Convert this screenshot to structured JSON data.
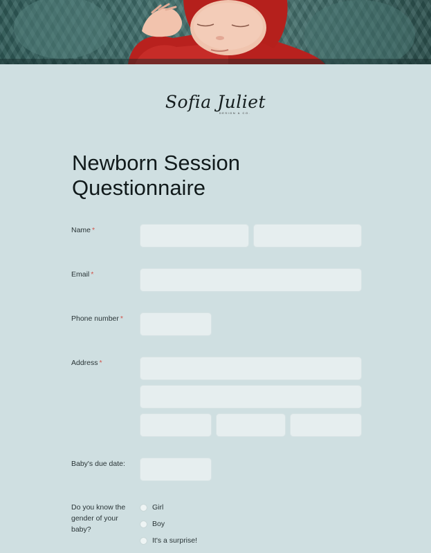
{
  "brand": {
    "name": "Sofia Juliet",
    "tagline": "DESIGN & CO."
  },
  "form": {
    "title_line1": "Newborn Session",
    "title_line2": "Questionnaire",
    "required_marker": "*",
    "fields": {
      "name": {
        "label": "Name",
        "first_value": "",
        "last_value": ""
      },
      "email": {
        "label": "Email",
        "value": ""
      },
      "phone": {
        "label": "Phone number",
        "value": ""
      },
      "address": {
        "label": "Address",
        "line1": "",
        "line2": "",
        "city": "",
        "state": "",
        "zip": ""
      },
      "due_date": {
        "label": "Baby's due date:",
        "value": ""
      },
      "gender": {
        "label": "Do you know the gender of your baby?",
        "options": [
          "Girl",
          "Boy",
          "It's a surprise!"
        ],
        "selected": null
      }
    }
  },
  "colors": {
    "background": "#cfdfe1",
    "field": "#e6eeef",
    "required": "#d0554c",
    "text": "#1f2a2c"
  }
}
